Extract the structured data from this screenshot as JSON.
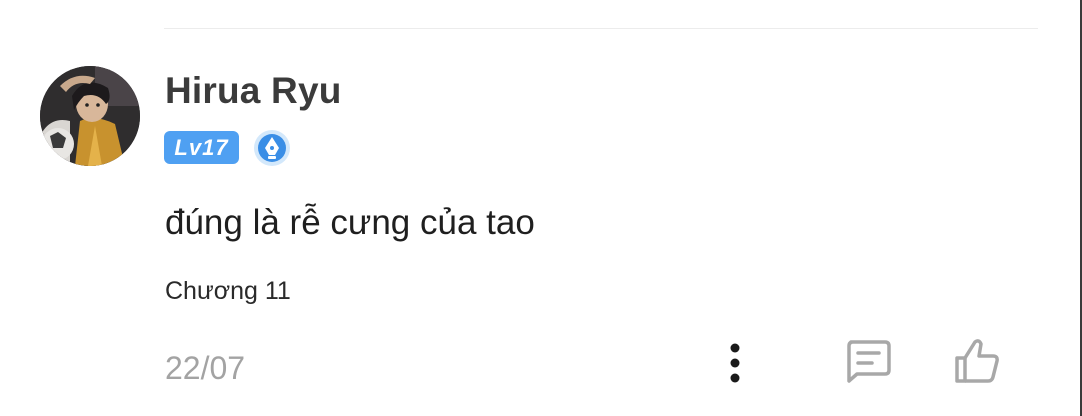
{
  "comment": {
    "username": "Hirua Ryu",
    "level": "Lv17",
    "text": "đúng là rễ cưng của tao",
    "chapter": "Chương 11",
    "date": "22/07"
  },
  "icons": {
    "avatar": "user-avatar",
    "badge": "pen-nib-badge-icon",
    "more": "more-vertical-icon",
    "reply": "comment-icon",
    "like": "thumbs-up-icon"
  },
  "colors": {
    "level_badge": "#4fa0f2",
    "username": "#3b3b3b",
    "date": "#a3a3a3",
    "icon_gray": "#a8a8a8"
  }
}
